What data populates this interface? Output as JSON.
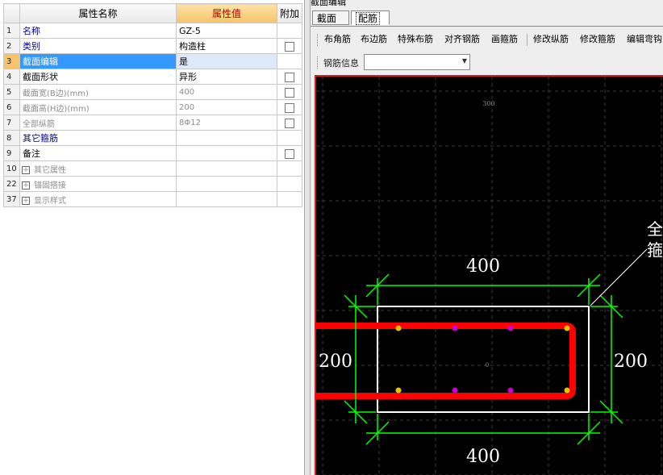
{
  "property_grid": {
    "headers": {
      "name": "属性名称",
      "value": "属性值",
      "extra": "附加"
    },
    "rows": [
      {
        "num": "1",
        "name": "名称",
        "value": "GZ-5",
        "style": "blue",
        "checkbox": false
      },
      {
        "num": "2",
        "name": "类别",
        "value": "构造柱",
        "style": "blue",
        "checkbox": true
      },
      {
        "num": "3",
        "name": "截面编辑",
        "value": "是",
        "style": "selected",
        "checkbox": false
      },
      {
        "num": "4",
        "name": "截面形状",
        "value": "异形",
        "style": "normal",
        "checkbox": true
      },
      {
        "num": "5",
        "name": "截面宽(B边)(mm)",
        "value": "400",
        "style": "grey",
        "checkbox": true
      },
      {
        "num": "6",
        "name": "截面高(H边)(mm)",
        "value": "200",
        "style": "grey",
        "checkbox": true
      },
      {
        "num": "7",
        "name": "全部纵筋",
        "value": "8Φ12",
        "style": "grey",
        "checkbox": true
      },
      {
        "num": "8",
        "name": "其它箍筋",
        "value": "",
        "style": "blue",
        "checkbox": false
      },
      {
        "num": "9",
        "name": "备注",
        "value": "",
        "style": "normal",
        "checkbox": true
      },
      {
        "num": "10",
        "name": "其它属性",
        "value": "",
        "style": "group",
        "checkbox": false
      },
      {
        "num": "22",
        "name": "锚固搭接",
        "value": "",
        "style": "group",
        "checkbox": false
      },
      {
        "num": "37",
        "name": "显示样式",
        "value": "",
        "style": "group",
        "checkbox": false
      }
    ]
  },
  "section_editor": {
    "window_title": "截面编辑",
    "tabs": [
      "截面",
      "配筋"
    ],
    "active_tab": "配筋",
    "toolbar": [
      "布角筋",
      "布边筋",
      "特殊布筋",
      "对齐钢筋",
      "画箍筋",
      "修改纵筋",
      "修改箍筋",
      "编辑弯钩"
    ],
    "rebar_info_label": "钢筋信息",
    "rebar_info_value": "",
    "canvas": {
      "dim_top": "400",
      "dim_bottom": "400",
      "dim_left": "200",
      "dim_right": "200",
      "grid_label_top": "300",
      "center_label": "0",
      "callout_line1": "全",
      "callout_line2": "箍"
    }
  },
  "colors": {
    "canvas_bg": "#000000",
    "dimension": "#00ff00",
    "outline": "#ffffff",
    "stirrup": "#ff0000",
    "corner_bar": "#e8c200",
    "side_bar": "#c800c8",
    "selected_row": "#3399ff",
    "value_header": "#f6c46a"
  }
}
